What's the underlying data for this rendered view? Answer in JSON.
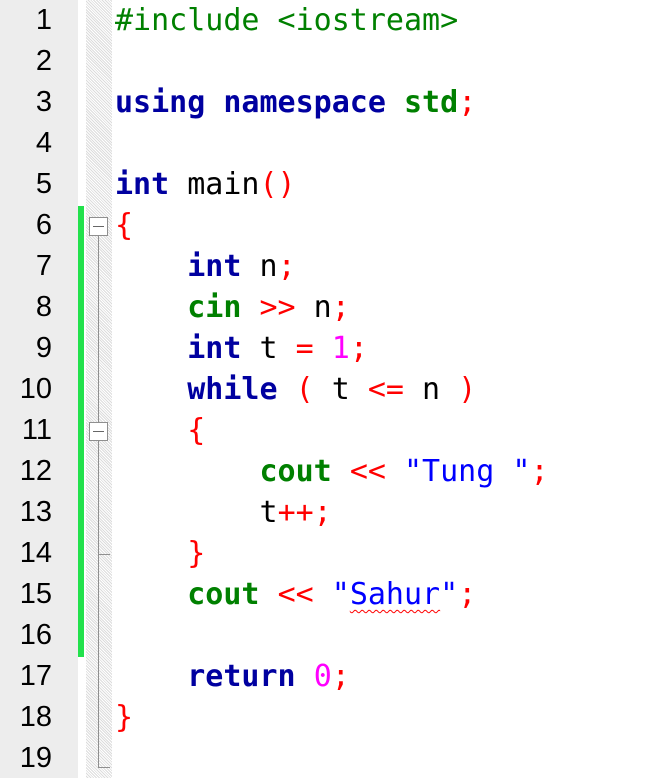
{
  "editor": {
    "line_numbers": [
      "1",
      "2",
      "3",
      "4",
      "5",
      "6",
      "7",
      "8",
      "9",
      "10",
      "11",
      "12",
      "13",
      "14",
      "15",
      "16",
      "17",
      "18",
      "19"
    ],
    "lines": [
      [
        {
          "t": "#include <iostream>",
          "c": "pp"
        }
      ],
      [],
      [
        {
          "t": "using",
          "c": "kw"
        },
        {
          "t": " ",
          "c": "plain"
        },
        {
          "t": "namespace",
          "c": "kw"
        },
        {
          "t": " ",
          "c": "plain"
        },
        {
          "t": "std",
          "c": "id"
        },
        {
          "t": ";",
          "c": "op"
        }
      ],
      [],
      [
        {
          "t": "int",
          "c": "ty"
        },
        {
          "t": " main",
          "c": "plain"
        },
        {
          "t": "()",
          "c": "op"
        }
      ],
      [
        {
          "t": "{",
          "c": "op"
        }
      ],
      [
        {
          "t": "    ",
          "c": "plain"
        },
        {
          "t": "int",
          "c": "ty"
        },
        {
          "t": " n",
          "c": "plain"
        },
        {
          "t": ";",
          "c": "op"
        }
      ],
      [
        {
          "t": "    ",
          "c": "plain"
        },
        {
          "t": "cin",
          "c": "id"
        },
        {
          "t": " ",
          "c": "plain"
        },
        {
          "t": ">>",
          "c": "op"
        },
        {
          "t": " n",
          "c": "plain"
        },
        {
          "t": ";",
          "c": "op"
        }
      ],
      [
        {
          "t": "    ",
          "c": "plain"
        },
        {
          "t": "int",
          "c": "ty"
        },
        {
          "t": " t ",
          "c": "plain"
        },
        {
          "t": "=",
          "c": "op"
        },
        {
          "t": " ",
          "c": "plain"
        },
        {
          "t": "1",
          "c": "num"
        },
        {
          "t": ";",
          "c": "op"
        }
      ],
      [
        {
          "t": "    ",
          "c": "plain"
        },
        {
          "t": "while",
          "c": "kw"
        },
        {
          "t": " ",
          "c": "plain"
        },
        {
          "t": "(",
          "c": "op"
        },
        {
          "t": " t ",
          "c": "plain"
        },
        {
          "t": "<=",
          "c": "op"
        },
        {
          "t": " n ",
          "c": "plain"
        },
        {
          "t": ")",
          "c": "op"
        }
      ],
      [
        {
          "t": "    ",
          "c": "plain"
        },
        {
          "t": "{",
          "c": "op"
        }
      ],
      [
        {
          "t": "        ",
          "c": "plain"
        },
        {
          "t": "cout",
          "c": "id"
        },
        {
          "t": " ",
          "c": "plain"
        },
        {
          "t": "<<",
          "c": "op"
        },
        {
          "t": " ",
          "c": "plain"
        },
        {
          "t": "\"Tung \"",
          "c": "str"
        },
        {
          "t": ";",
          "c": "op"
        }
      ],
      [
        {
          "t": "        t",
          "c": "plain"
        },
        {
          "t": "++;",
          "c": "op"
        }
      ],
      [
        {
          "t": "    ",
          "c": "plain"
        },
        {
          "t": "}",
          "c": "op"
        }
      ],
      [
        {
          "t": "    ",
          "c": "plain"
        },
        {
          "t": "cout",
          "c": "id"
        },
        {
          "t": " ",
          "c": "plain"
        },
        {
          "t": "<<",
          "c": "op"
        },
        {
          "t": " ",
          "c": "plain"
        },
        {
          "t": "\"",
          "c": "str"
        },
        {
          "t": "Sahur",
          "c": "str",
          "squiggle": true
        },
        {
          "t": "\"",
          "c": "str"
        },
        {
          "t": ";",
          "c": "op"
        }
      ],
      [],
      [
        {
          "t": "    ",
          "c": "plain"
        },
        {
          "t": "return",
          "c": "kw"
        },
        {
          "t": " ",
          "c": "plain"
        },
        {
          "t": "0",
          "c": "num"
        },
        {
          "t": ";",
          "c": "op"
        }
      ],
      [
        {
          "t": "}",
          "c": "op"
        }
      ],
      []
    ]
  },
  "colors": {
    "keyword": "#0000a0",
    "identifier": "#008000",
    "operator": "#ff0000",
    "number": "#ff00ff",
    "string": "#0000ff",
    "preprocessor": "#008000",
    "change_marker": "#22e14c",
    "gutter_background": "#ededed"
  },
  "icons": {
    "fold": "fold-minus-icon"
  }
}
